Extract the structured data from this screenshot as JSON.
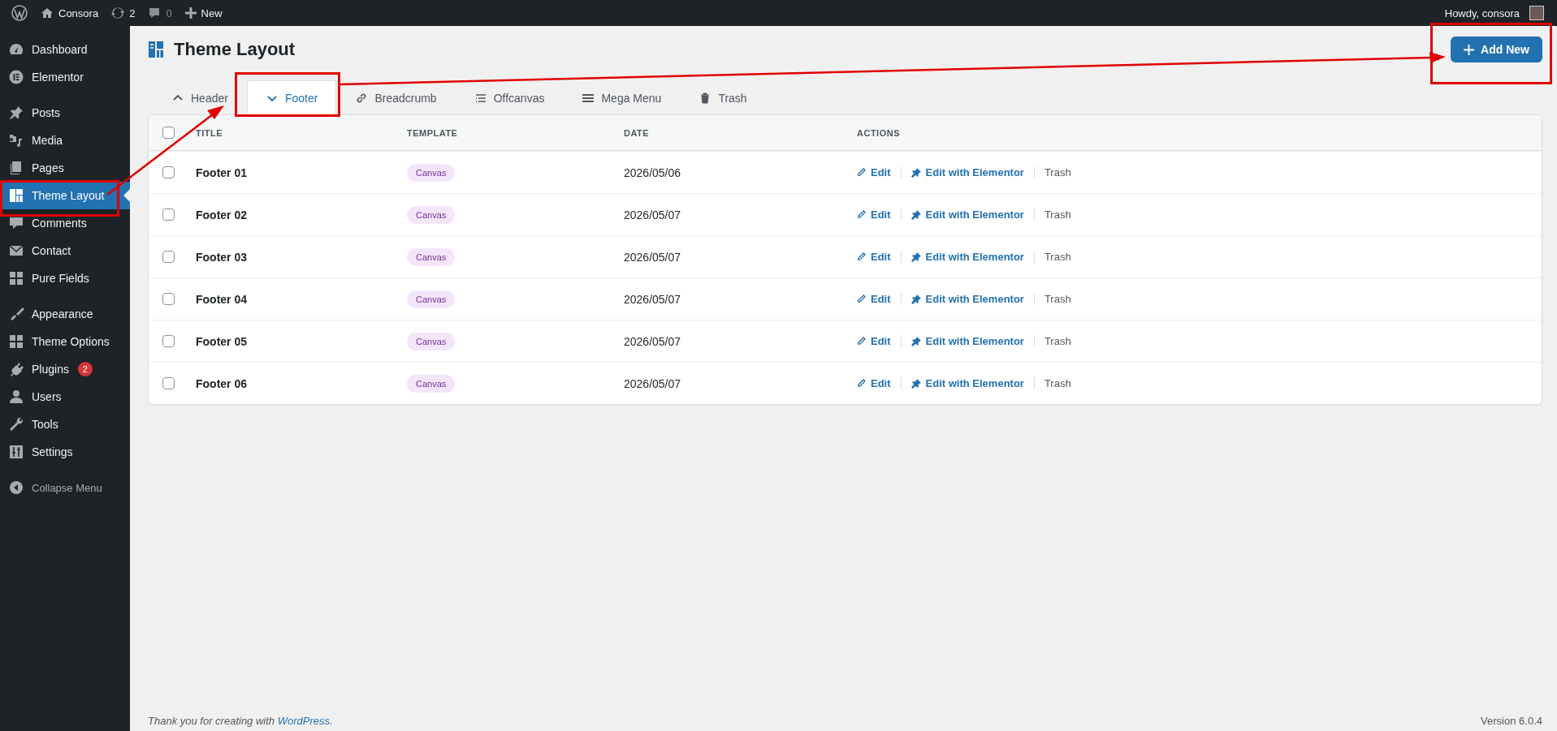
{
  "admin_bar": {
    "site_name": "Consora",
    "updates": "2",
    "comments": "0",
    "new": "New",
    "greeting": "Howdy, consora"
  },
  "sidebar": {
    "groups": [
      {
        "items": [
          {
            "label": "Dashboard",
            "selected": false
          },
          {
            "label": "Elementor",
            "selected": false
          }
        ]
      },
      {
        "items": [
          {
            "label": "Posts",
            "selected": false
          },
          {
            "label": "Media",
            "selected": false
          },
          {
            "label": "Pages",
            "selected": false
          },
          {
            "label": "Theme Layout",
            "selected": true
          },
          {
            "label": "Comments",
            "selected": false
          },
          {
            "label": "Contact",
            "selected": false
          },
          {
            "label": "Pure Fields",
            "selected": false
          }
        ]
      },
      {
        "items": [
          {
            "label": "Appearance",
            "selected": false
          },
          {
            "label": "Theme Options",
            "selected": false
          },
          {
            "label": "Plugins",
            "selected": false,
            "badge": "2"
          },
          {
            "label": "Users",
            "selected": false
          },
          {
            "label": "Tools",
            "selected": false
          },
          {
            "label": "Settings",
            "selected": false
          }
        ]
      }
    ],
    "collapse": "Collapse Menu"
  },
  "page": {
    "title": "Theme Layout",
    "add_button": "Add New"
  },
  "tabs": [
    {
      "label": "Header",
      "selected": false
    },
    {
      "label": "Footer",
      "selected": true
    },
    {
      "label": "Breadcrumb",
      "selected": false
    },
    {
      "label": "Offcanvas",
      "selected": false
    },
    {
      "label": "Mega Menu",
      "selected": false
    },
    {
      "label": "Trash",
      "selected": false
    }
  ],
  "table": {
    "columns": [
      "TITLE",
      "TEMPLATE",
      "DATE",
      "ACTIONS"
    ],
    "select_all_checked": false,
    "rows": [
      {
        "checked": false,
        "title": "Footer 01",
        "template": "Canvas",
        "date": "2026/05/06",
        "actions": [
          "Edit",
          "Edit with Elementor",
          "Trash"
        ]
      },
      {
        "checked": false,
        "title": "Footer 02",
        "template": "Canvas",
        "date": "2026/05/07",
        "actions": [
          "Edit",
          "Edit with Elementor",
          "Trash"
        ]
      },
      {
        "checked": false,
        "title": "Footer 03",
        "template": "Canvas",
        "date": "2026/05/07",
        "actions": [
          "Edit",
          "Edit with Elementor",
          "Trash"
        ]
      },
      {
        "checked": false,
        "title": "Footer 04",
        "template": "Canvas",
        "date": "2026/05/07",
        "actions": [
          "Edit",
          "Edit with Elementor",
          "Trash"
        ]
      },
      {
        "checked": false,
        "title": "Footer 05",
        "template": "Canvas",
        "date": "2026/05/07",
        "actions": [
          "Edit",
          "Edit with Elementor",
          "Trash"
        ]
      },
      {
        "checked": false,
        "title": "Footer 06",
        "template": "Canvas",
        "date": "2026/05/07",
        "actions": [
          "Edit",
          "Edit with Elementor",
          "Trash"
        ]
      }
    ]
  },
  "footer": {
    "thanks": "Thank you for creating with",
    "link": "WordPress",
    "end": ".",
    "version": "Version 6.0.4"
  }
}
